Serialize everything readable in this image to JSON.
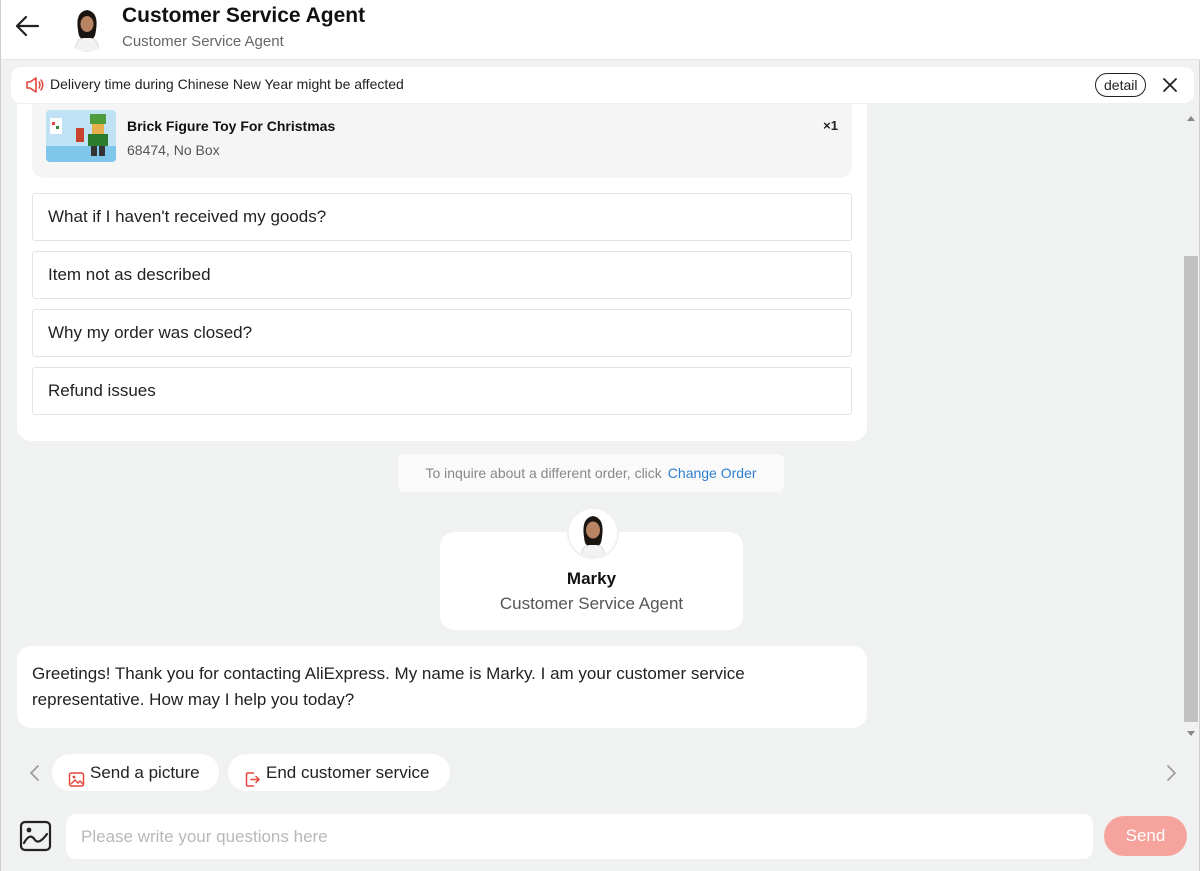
{
  "header": {
    "title": "Customer Service Agent",
    "subtitle": "Customer Service Agent"
  },
  "notice": {
    "text": "Delivery time during Chinese New Year might be affected",
    "detail_label": "detail"
  },
  "order": {
    "product_name": "Brick Figure Toy For Christmas",
    "variant": "68474, No Box",
    "quantity": "×1"
  },
  "faq": [
    "What if I haven't received my goods?",
    "Item not as described",
    "Why my order was closed?",
    "Refund issues"
  ],
  "change_order": {
    "hint": "To inquire about a different order, click",
    "link": "Change Order"
  },
  "agent": {
    "name": "Marky",
    "role": "Customer Service Agent"
  },
  "greeting": "Greetings! Thank you for contacting AliExpress. My name is Marky. I am your customer service representative. How may I help you today?",
  "quick_actions": {
    "send_picture": "Send a picture",
    "end_service": "End customer service"
  },
  "composer": {
    "placeholder": "Please write your questions here",
    "send_label": "Send"
  },
  "colors": {
    "accent": "#f6a39d",
    "link": "#2f7fd0",
    "icon_red": "#e6463c"
  }
}
